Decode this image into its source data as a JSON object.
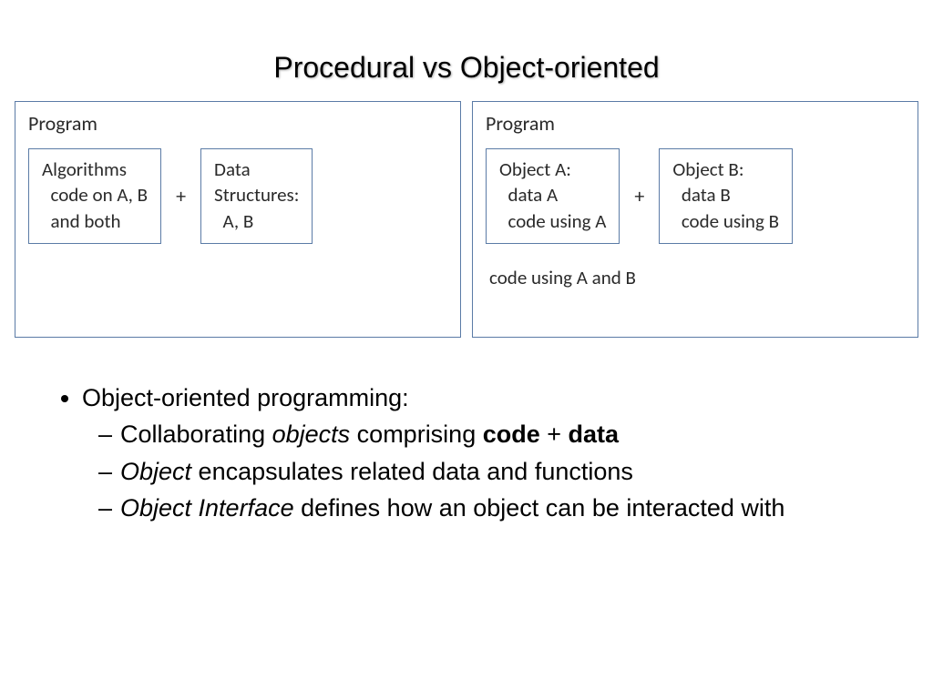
{
  "title": "Procedural vs Object-oriented",
  "leftPanel": {
    "label": "Program",
    "box1": "Algorithms\n  code on A, B\n  and both",
    "plus": "+",
    "box2": "Data\nStructures:\n  A, B"
  },
  "rightPanel": {
    "label": "Program",
    "box1": "Object A:\n  data A\n  code using A",
    "plus": "+",
    "box2": "Object B:\n  data B\n  code using B",
    "footer": "code using A and B"
  },
  "bullets": {
    "top": "Object-oriented programming:",
    "sub1_a": "Collaborating ",
    "sub1_b": "objects",
    "sub1_c": " comprising ",
    "sub1_d": "code",
    "sub1_e": " + ",
    "sub1_f": "data",
    "sub2_a": "Object",
    "sub2_b": " encapsulates related data and functions",
    "sub3_a": "Object Interface",
    "sub3_b": " defines how an object can be interacted with"
  }
}
